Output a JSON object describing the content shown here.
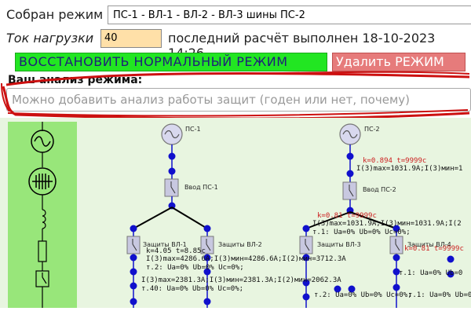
{
  "header": {
    "mode_label": "Собран режим",
    "mode_value": "ПС-1 - ВЛ-1 - ВЛ-2 - ВЛ-3 шины ПС-2",
    "load_label": "Ток нагрузки",
    "load_value": "40",
    "last_calc": "последний расчёт выполнен 18-10-2023 14:26"
  },
  "buttons": {
    "restore": "ВОССТАНОВИТЬ НОРМАЛЬНЫЙ РЕЖИМ",
    "delete": "Удалить РЕЖИМ"
  },
  "analysis": {
    "title": "Ваш анализ режима:",
    "placeholder": "Можно добавить анализ работы защит (годен или нет, почему)"
  },
  "palette": {
    "icons": [
      "generator-icon",
      "grid-source-icon",
      "inductor-icon",
      "resistor-icon",
      "switch-icon"
    ]
  },
  "scheme": {
    "labels": {
      "ps1": "ПС-1",
      "ps2": "ПС-2",
      "vvod1": "Ввод ПС-1",
      "vvod2": "Ввод ПС-2",
      "zvl1": "Защиты ВЛ-1",
      "zvl2": "Защиты ВЛ-2",
      "zvl3": "Защиты ВЛ-3",
      "zvl4": "Защиты ВЛ-4"
    },
    "notes_red": {
      "ps2_kt": "k=0.894 t=9999c",
      "vl3_kt": "k=0.81 t=9999c",
      "vl4_kt": "k=0.81 t=9999c"
    },
    "notes": {
      "vl1_kt": "k=4.05 t=8.85c",
      "ps2_i": "I(3)max=1031.9A;I(3)мин=1",
      "vl3_i": "I(3)max=1031.9A;I(3)мин=1031.9A;I(2",
      "vl3_u": "т.1: Ua=0% Ub=0% Uc=0%;",
      "vl1_i": "I(3)max=4286.6A;I(3)мин=4286.6A;I(2)мин=3712.3A",
      "vl1_u": "т.2: Ua=0% Ub=0% Uc=0%;",
      "vl4_u": "т.1: Ua=0% Ub=0",
      "bot_i": "I(3)max=2381.3A;I(3)мин=2381.3A;I(2)мин=2062.3A",
      "bot_u": "т.40: Ua=0% Ub=0% Uc=0%;",
      "bot_u2": "т.2: Ua=0% Ub=0% Uc=0%;",
      "bot_u3": "т.1: Ua=0% Ub=0"
    }
  },
  "colors": {
    "restore_bg": "#22e622",
    "delete_bg": "#e67b7b",
    "load_bg": "#ffe0a8",
    "palette_bg": "#98e67a",
    "workspace_bg": "#e8f5e0",
    "node": "#1010cc",
    "red_scribble": "#cc1010"
  }
}
